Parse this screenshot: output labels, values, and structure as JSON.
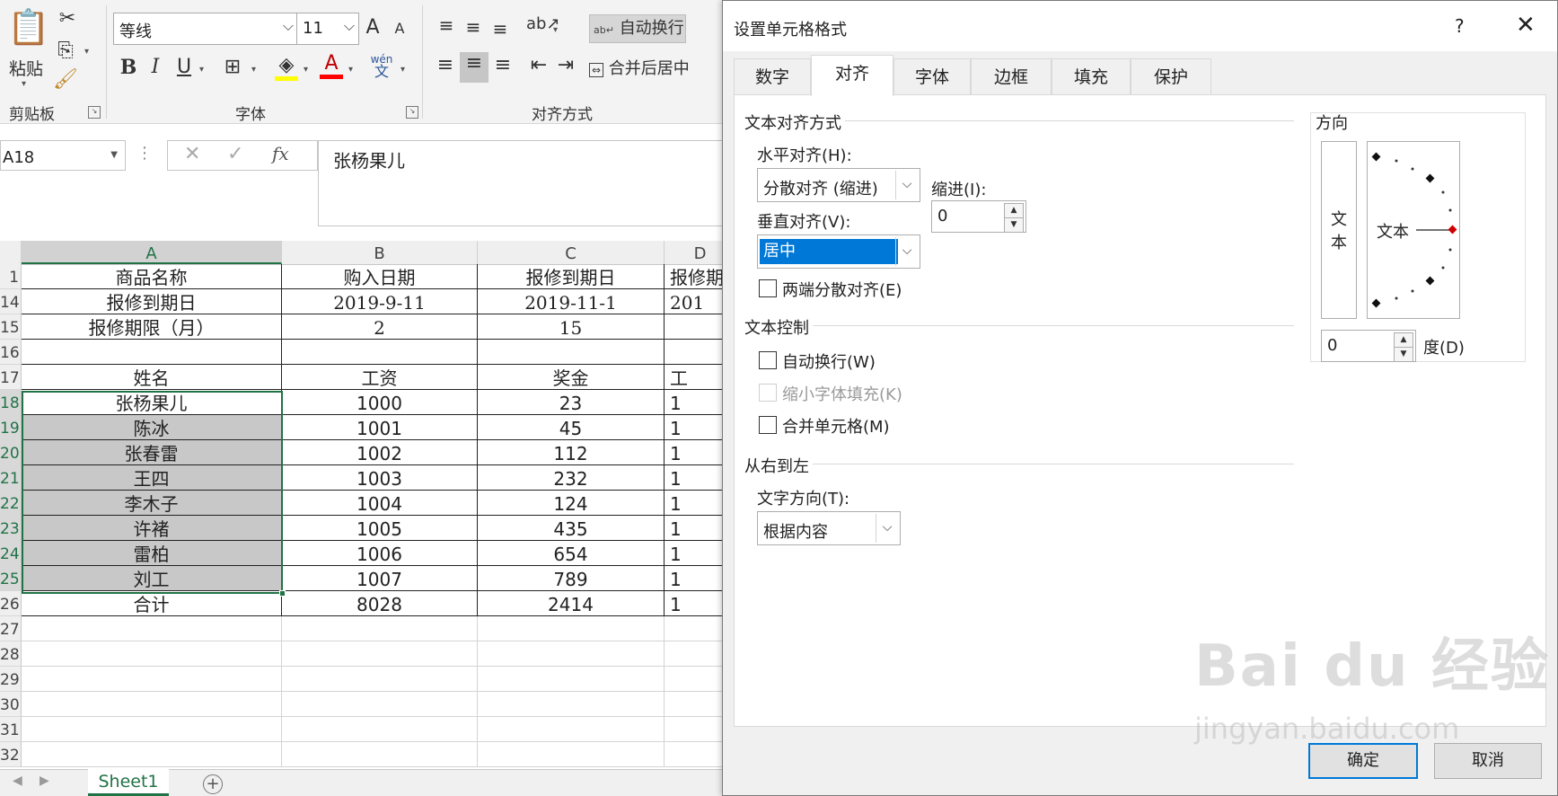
{
  "ribbon": {
    "clipboard": {
      "paste_label": "粘贴",
      "group_label": "剪贴板"
    },
    "font": {
      "name": "等线",
      "size": "11",
      "group_label": "字体",
      "bold": "B",
      "italic": "I",
      "underline": "U",
      "grow": "A",
      "shrink": "A",
      "phonetic_top": "wén",
      "phonetic_bottom": "文"
    },
    "alignment": {
      "wrap_label": "自动换行",
      "merge_label": "合并后居中",
      "group_label": "对齐方式"
    }
  },
  "formula_bar": {
    "name_box": "A18",
    "fx": "fx",
    "content": "张杨果儿"
  },
  "sheet": {
    "columns": [
      "A",
      "B",
      "C",
      "D"
    ],
    "rows": [
      {
        "num": "1",
        "a": "商品名称",
        "b": "购入日期",
        "c": "报修到期日",
        "d": "报修期"
      },
      {
        "num": "14",
        "a": "报修到期日",
        "b": "2019-9-11",
        "c": "2019-11-1",
        "d": "201"
      },
      {
        "num": "15",
        "a": "报修期限（月）",
        "b": "2",
        "c": "15",
        "d": ""
      },
      {
        "num": "16",
        "a": "",
        "b": "",
        "c": "",
        "d": ""
      },
      {
        "num": "17",
        "a": "姓名",
        "b": "工资",
        "c": "奖金",
        "d": "工"
      },
      {
        "num": "18",
        "a": "张杨果儿",
        "b": "1000",
        "c": "23",
        "d": "1"
      },
      {
        "num": "19",
        "a": "陈冰",
        "b": "1001",
        "c": "45",
        "d": "1"
      },
      {
        "num": "20",
        "a": "张春雷",
        "b": "1002",
        "c": "112",
        "d": "1"
      },
      {
        "num": "21",
        "a": "王四",
        "b": "1003",
        "c": "232",
        "d": "1"
      },
      {
        "num": "22",
        "a": "李木子",
        "b": "1004",
        "c": "124",
        "d": "1"
      },
      {
        "num": "23",
        "a": "许褚",
        "b": "1005",
        "c": "435",
        "d": "1"
      },
      {
        "num": "24",
        "a": "雷柏",
        "b": "1006",
        "c": "654",
        "d": "1"
      },
      {
        "num": "25",
        "a": "刘工",
        "b": "1007",
        "c": "789",
        "d": "1"
      },
      {
        "num": "26",
        "a": "合计",
        "b": "8028",
        "c": "2414",
        "d": "1"
      },
      {
        "num": "27",
        "a": "",
        "b": "",
        "c": "",
        "d": ""
      },
      {
        "num": "28",
        "a": "",
        "b": "",
        "c": "",
        "d": ""
      },
      {
        "num": "29",
        "a": "",
        "b": "",
        "c": "",
        "d": ""
      },
      {
        "num": "30",
        "a": "",
        "b": "",
        "c": "",
        "d": ""
      },
      {
        "num": "31",
        "a": "",
        "b": "",
        "c": "",
        "d": ""
      },
      {
        "num": "32",
        "a": "",
        "b": "",
        "c": "",
        "d": ""
      }
    ],
    "tab_name": "Sheet1"
  },
  "dialog": {
    "title": "设置单元格格式",
    "help": "?",
    "close": "✕",
    "tabs": [
      "数字",
      "对齐",
      "字体",
      "边框",
      "填充",
      "保护"
    ],
    "active_tab": "对齐",
    "text_alignment": {
      "section": "文本对齐方式",
      "horizontal_label": "水平对齐(H):",
      "horizontal_value": "分散对齐 (缩进)",
      "vertical_label": "垂直对齐(V):",
      "vertical_value": "居中",
      "indent_label": "缩进(I):",
      "indent_value": "0",
      "justify_distributed": "两端分散对齐(E)"
    },
    "text_control": {
      "section": "文本控制",
      "wrap": "自动换行(W)",
      "shrink": "缩小字体填充(K)",
      "merge": "合并单元格(M)"
    },
    "rtl": {
      "section": "从右到左",
      "direction_label": "文字方向(T):",
      "direction_value": "根据内容"
    },
    "orientation": {
      "section": "方向",
      "vertical_text": "文\n本",
      "dial_text": "文本",
      "degrees_value": "0",
      "degrees_label": "度(D)"
    },
    "ok": "确定",
    "cancel": "取消"
  },
  "watermark": {
    "main": "Bai du 经验",
    "sub": "jingyan.baidu.com"
  },
  "colors": {
    "excel_green": "#217346",
    "selection_blue": "#0078d7",
    "selected_gray": "#c8c8c8"
  }
}
